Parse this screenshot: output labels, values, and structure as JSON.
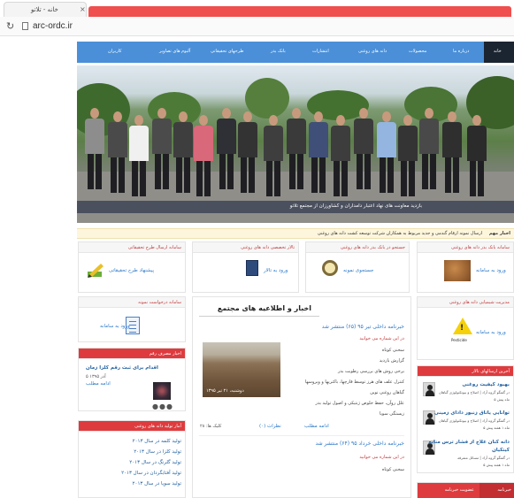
{
  "browser": {
    "tab_title": "خانه - تلاتو",
    "tab_close": "×",
    "url": "arc-ordc.ir"
  },
  "nav": {
    "home": "خانه",
    "items": [
      "درباره ما",
      "محصولات",
      "دانه های روغنی",
      "انتشارات",
      "بانک بذر",
      "طرحهای تحقیقاتی",
      "آلبوم های تصاویر",
      "کاربران"
    ]
  },
  "hero": {
    "caption": "بازدید معاونت های نهاد اعتبار دامداران و کشاورزان از مجتمع تلاتو"
  },
  "ticker": {
    "label": "اخبار مهم",
    "text": "ارسال نمونه ارقام گندمی و جدید مربوط به همکاران شرکت توسعه کشت دانه های روغنی"
  },
  "boxes": {
    "seed_bank": {
      "title": "سامانه بانک بذر دانه های روغنی",
      "link": "ورود به سامانه"
    },
    "search": {
      "title": "جستجو در بانک بذر دانه های روغنی",
      "link": "جستجوی نمونه"
    },
    "specialist": {
      "title": "تالار تخصصی دانه های روغنی",
      "link": "ورود به تالار"
    },
    "research": {
      "title": "سامانه ارسال طرح تحقیقاتی",
      "link": "پیشنهاد طرح تحقیقاتی"
    },
    "pest": {
      "title": "مدیریت شیمیایی دانه های روغنی",
      "link": "ورود به سامانه",
      "icon_text": "Pesticide"
    },
    "sample_request": {
      "title": "سامانه درخواست نمونه",
      "link": "ورود به سامانه"
    },
    "media": {
      "title": "اخبار مصرف رقم",
      "item_title": "اقدام برای ثبت رقم کلزا زمان",
      "item_date": "۵ آذر ۱۳۹۵",
      "item_more": "ادامه مطلب"
    },
    "stats": {
      "title": "آمار تولید دانه های روغنی",
      "items": [
        "تولید کلمه در سال ۲۰۱۳",
        "تولید کلزا در سال ۲۰۱۳",
        "تولید گلرنگ در سال ۲۰۱۳",
        "تولید آفتابگردان در سال ۲۰۱۳",
        "تولید سویا در سال ۲۰۱۳"
      ]
    },
    "forum": {
      "title": "آخرین ارسالهای تالار",
      "posts": [
        {
          "title": "بهبود کیفیت روغنی",
          "meta": "در گفتگو گروه آزاد | اصلاح و بیوتکنولوژی گیاهان",
          "time": "۵ ماه پیش"
        },
        {
          "title": "توانایی یاتاق زنبور دادای زمینی",
          "meta": "در گفتگو گروه آزاد | اصلاح و بیوتکنولوژی گیاهان",
          "time": "۵ ماه ۱ هفته پیش"
        },
        {
          "title": "دانه کتان علاج از فشار ترس منابع",
          "meta2": "کیتکیان",
          "meta": "در گفتگو گروه آزاد | مسائل متفرقه",
          "time": "۵ ماه ۱ هفته پیش"
        }
      ]
    },
    "newsletter": {
      "title": "عضویت خبرنامه",
      "label": "خبرنامه"
    }
  },
  "main": {
    "title": "اخبار و اطلاعیه های مجتمع",
    "news1": {
      "title": "خبرنامه داخلی تیر ۹۵ (۶۵) منتشر شد",
      "subtitle": "در این شماره می خوانید",
      "lines": [
        "سخنی کوتاه",
        "گزارش بازدید",
        "برخی روش های بررسی رطوبت بذر",
        "کنترل علف های هرز توسط قارچها، باکتریها و ویروسها",
        "گیاهان روغنی نوین",
        "علل روآن، حفظ خلوص ژنتیکی و اصول تولید بذر",
        "زیستگی سویا"
      ],
      "image_caption": "دوشنبه، ۲۱ تیر ۱۳۹۵",
      "more": "ادامه مطلب",
      "comments": "نظرات (۰)",
      "hits": "کلیک ها: ۲۸"
    },
    "news2": {
      "title": "خبرنامه داخلی خرداد ۹۵ (۶۴) منتشر شد",
      "subtitle": "در این شماره می خوانید",
      "line": "سخنی کوتاه"
    }
  },
  "colors": {
    "nav": "#4a8fd8",
    "nav_home": "#1b2431",
    "accent_red": "#de3b3e",
    "link": "#2a78c8",
    "tab_strip": "#ef4f4f"
  }
}
